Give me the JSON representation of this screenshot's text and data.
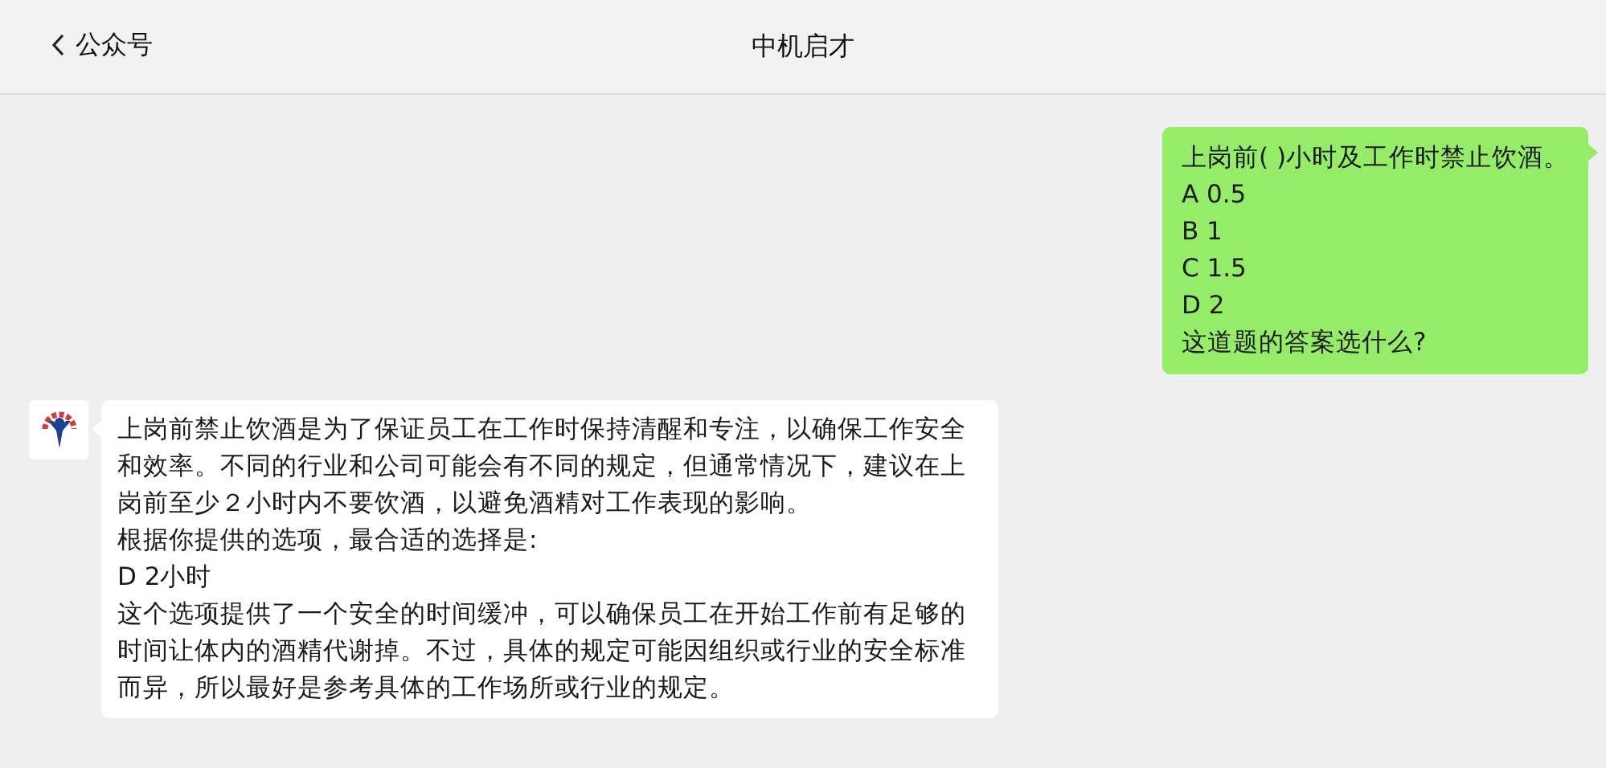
{
  "header": {
    "back_label": "公众号",
    "title": "中机启才"
  },
  "messages": [
    {
      "kind": "sent",
      "lines": [
        "上岗前( )小时及工作时禁止饮酒。",
        "A 0.5",
        "B 1",
        "C 1.5",
        "D 2",
        "这道题的答案选什么?"
      ]
    },
    {
      "kind": "received",
      "lines": [
        "上岗前禁止饮酒是为了保证员工在工作时保持清醒和专注，以确保工作安全和效率。不同的行业和公司可能会有不同的规定，但通常情况下，建议在上岗前至少２小时内不要饮酒，以避免酒精对工作表现的影响。",
        "根据你提供的选项，最合适的选择是:",
        "D 2小时",
        "这个选项提供了一个安全的时间缓冲，可以确保员工在开始工作前有足够的时间让体内的酒精代谢掉。不过，具体的规定可能因组织或行业的安全标准而异，所以最好是参考具体的工作场所或行业的规定。"
      ]
    }
  ]
}
